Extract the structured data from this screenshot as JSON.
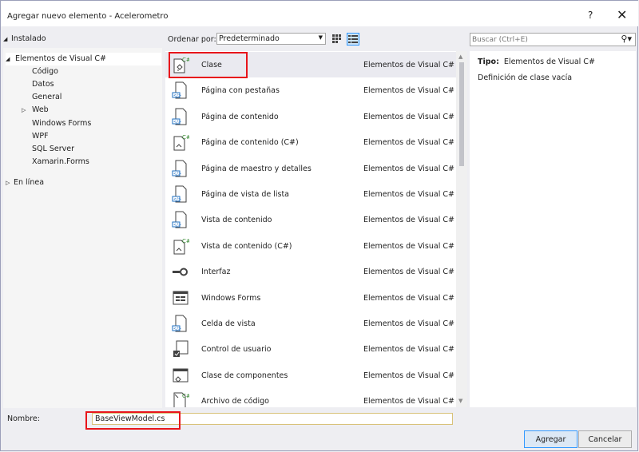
{
  "window": {
    "title": "Agregar nuevo elemento - Acelerometro",
    "help": "?",
    "close": "✕"
  },
  "tree": {
    "installed": "Instalado",
    "visual_csharp": "Elementos de Visual C#",
    "children": [
      "Código",
      "Datos",
      "General",
      "Web",
      "Windows Forms",
      "WPF",
      "SQL Server",
      "Xamarin.Forms"
    ],
    "online": "En línea"
  },
  "toolbar": {
    "order_label": "Ordenar por:",
    "order_value": "Predeterminado"
  },
  "search": {
    "placeholder": "Buscar (Ctrl+E)"
  },
  "templates": [
    {
      "name": "Clase",
      "category": "Elementos de Visual C#",
      "icon": "csharp-class-icon"
    },
    {
      "name": "Página con pestañas",
      "category": "Elementos de Visual C#",
      "icon": "xaml-page-icon"
    },
    {
      "name": "Página de contenido",
      "category": "Elementos de Visual C#",
      "icon": "xaml-page-icon"
    },
    {
      "name": "Página de contenido (C#)",
      "category": "Elementos de Visual C#",
      "icon": "csharp-page-icon"
    },
    {
      "name": "Página de maestro y detalles",
      "category": "Elementos de Visual C#",
      "icon": "xaml-page-icon"
    },
    {
      "name": "Página de vista de lista",
      "category": "Elementos de Visual C#",
      "icon": "xaml-page-icon"
    },
    {
      "name": "Vista de contenido",
      "category": "Elementos de Visual C#",
      "icon": "xaml-page-icon"
    },
    {
      "name": "Vista de contenido (C#)",
      "category": "Elementos de Visual C#",
      "icon": "csharp-page-icon"
    },
    {
      "name": "Interfaz",
      "category": "Elementos de Visual C#",
      "icon": "interface-icon"
    },
    {
      "name": "Windows Forms",
      "category": "Elementos de Visual C#",
      "icon": "windows-form-icon"
    },
    {
      "name": "Celda de vista",
      "category": "Elementos de Visual C#",
      "icon": "xaml-page-icon"
    },
    {
      "name": "Control de usuario",
      "category": "Elementos de Visual C#",
      "icon": "user-control-icon"
    },
    {
      "name": "Clase de componentes",
      "category": "Elementos de Visual C#",
      "icon": "component-class-icon"
    },
    {
      "name": "Archivo de código",
      "category": "Elementos de Visual C#",
      "icon": "code-file-icon"
    }
  ],
  "details": {
    "type_label": "Tipo:",
    "type_value": "Elementos de Visual C#",
    "description": "Definición de clase vacía"
  },
  "bottom": {
    "name_label": "Nombre:",
    "name_value": "BaseViewModel.cs",
    "add": "Agregar",
    "cancel": "Cancelar"
  },
  "colors": {
    "highlight": "#e8151b",
    "accent": "#3399ff",
    "csharp_green": "#388a34"
  }
}
